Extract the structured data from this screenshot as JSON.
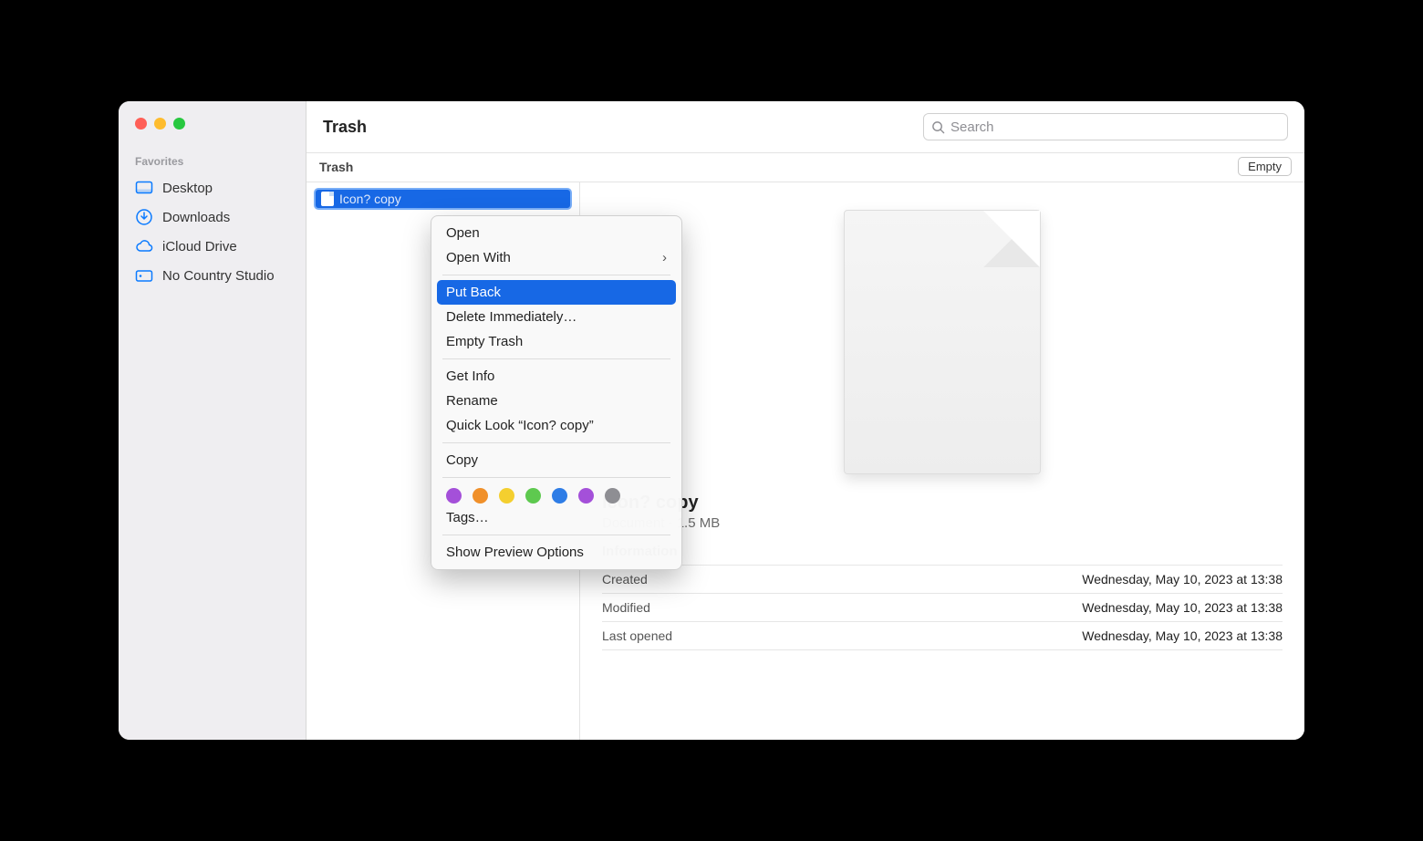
{
  "sidebar": {
    "section": "Favorites",
    "items": [
      {
        "label": "Desktop"
      },
      {
        "label": "Downloads"
      },
      {
        "label": "iCloud Drive"
      },
      {
        "label": "No Country Studio"
      }
    ]
  },
  "toolbar": {
    "title": "Trash",
    "search_placeholder": "Search"
  },
  "subheader": {
    "title": "Trash",
    "empty": "Empty"
  },
  "file": {
    "name": "Icon? copy"
  },
  "preview": {
    "name": "Icon? copy",
    "kind_size": "Document - 1.5 MB",
    "info_header": "Information",
    "rows": {
      "created_label": "Created",
      "created_value": "Wednesday, May 10, 2023 at 13:38",
      "modified_label": "Modified",
      "modified_value": "Wednesday, May 10, 2023 at 13:38",
      "lastopened_label": "Last opened",
      "lastopened_value": "Wednesday, May 10, 2023 at 13:38"
    }
  },
  "menu": {
    "open": "Open",
    "openwith": "Open With",
    "putback": "Put Back",
    "delete": "Delete Immediately…",
    "emptytrash": "Empty Trash",
    "getinfo": "Get Info",
    "rename": "Rename",
    "quicklook": "Quick Look “Icon? copy”",
    "copy": "Copy",
    "tags": "Tags…",
    "previewoptions": "Show Preview Options",
    "tag_colors": [
      "#a450d9",
      "#f0902a",
      "#f4cf2f",
      "#5ec94f",
      "#2f7de6",
      "#a450d9",
      "#8e8e93"
    ]
  }
}
